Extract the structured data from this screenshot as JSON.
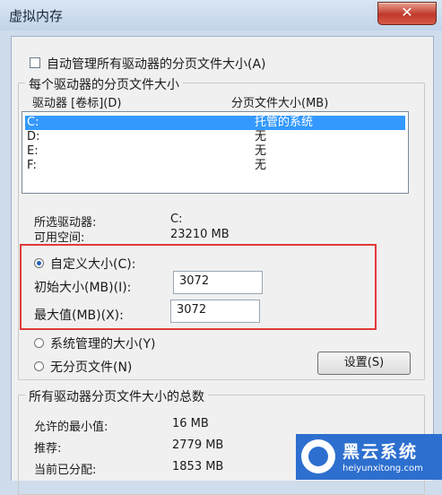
{
  "window": {
    "title": "虚拟内存",
    "close_glyph": "✕"
  },
  "auto_manage": {
    "label": "自动管理所有驱动器的分页文件大小(A)",
    "checked": false
  },
  "drives_group": {
    "title": "每个驱动器的分页文件大小",
    "col_drive": "驱动器 [卷标](D)",
    "col_size": "分页文件大小(MB)",
    "rows": [
      {
        "drive": "C:",
        "size": "托管的系统"
      },
      {
        "drive": "D:",
        "size": "无"
      },
      {
        "drive": "E:",
        "size": "无"
      },
      {
        "drive": "F:",
        "size": "无"
      }
    ],
    "selected_drive_label": "所选驱动器:",
    "selected_drive_value": "C:",
    "free_space_label": "可用空间:",
    "free_space_value": "23210 MB",
    "custom_size_label": "自定义大小(C):",
    "initial_size_label": "初始大小(MB)(I):",
    "initial_size_value": "3072",
    "max_size_label": "最大值(MB)(X):",
    "max_size_value": "3072",
    "system_managed_label": "系统管理的大小(Y)",
    "no_paging_label": "无分页文件(N)",
    "set_button": "设置(S)"
  },
  "totals_group": {
    "title": "所有驱动器分页文件大小的总数",
    "min_label": "允许的最小值:",
    "min_value": "16 MB",
    "recommended_label": "推荐:",
    "recommended_value": "2779 MB",
    "allocated_label": "当前已分配:",
    "allocated_value": "1853 MB"
  },
  "watermark": {
    "brand": "黑云系统",
    "url": "heiyunxitong.com"
  },
  "colors": {
    "selection": "#3399ff",
    "highlight_box": "#e03a3a",
    "watermark_bg": "#2d6fcf"
  }
}
